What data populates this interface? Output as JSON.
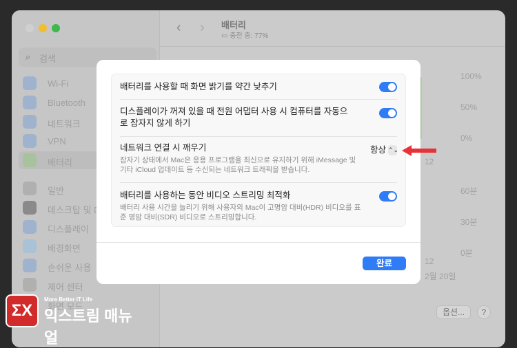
{
  "window": {
    "traffic_lights": [
      "#d0d0d0",
      "#f2be2c",
      "#3cb94a"
    ]
  },
  "sidebar": {
    "search_placeholder": "검색",
    "items": [
      {
        "label": "Wi-Fi",
        "icon": "wifi-icon"
      },
      {
        "label": "Bluetooth",
        "icon": "bluetooth-icon"
      },
      {
        "label": "네트워크",
        "icon": "globe-icon"
      },
      {
        "label": "VPN",
        "icon": "vpn-icon"
      },
      {
        "label": "배터리",
        "icon": "battery-icon",
        "selected": true
      },
      {
        "label": "일반",
        "icon": "gear-icon"
      },
      {
        "label": "데스크탑 및 Dock",
        "icon": "dock-icon"
      },
      {
        "label": "디스플레이",
        "icon": "sun-icon"
      },
      {
        "label": "배경화면",
        "icon": "wallpaper-icon"
      },
      {
        "label": "손쉬운 사용",
        "icon": "accessibility-icon"
      },
      {
        "label": "제어 센터",
        "icon": "control-center-icon"
      },
      {
        "label": "화면 모드",
        "icon": "screen-mode-icon"
      }
    ]
  },
  "header": {
    "title": "배터리",
    "status": "충전 중: 77%"
  },
  "chart": {
    "level_ticks": [
      "100%",
      "50%",
      "0%"
    ],
    "time_ticks": [
      "60분",
      "30분",
      "0분"
    ],
    "x_label_1": "12",
    "x_label_2": "12",
    "date": "2월 20일"
  },
  "footer": {
    "options": "옵션...",
    "help": "?"
  },
  "dialog": {
    "rows": [
      {
        "title": "배터리를 사용할 때 화면 밝기를 약간 낮추기",
        "toggle": true
      },
      {
        "title": "디스플레이가 꺼져 있을 때 전원 어댑터 사용 시 컴퓨터를 자동으로 잠자지 않게 하기",
        "toggle": true
      },
      {
        "title": "네트워크 연결 시 깨우기",
        "desc": "잠자기 상태에서 Mac은 응용 프로그램을 최신으로 유지하기 위해 iMessage 및 기타 iCloud 업데이트 등 수신되는 네트워크 트래픽을 받습니다.",
        "value": "항상"
      },
      {
        "title": "배터리를 사용하는 동안 비디오 스트리밍 최적화",
        "desc": "배터리 사용 시간을 늘리기 위해 사용자의 Mac이 고명암 대비(HDR) 비디오를 표준 명암 대비(SDR) 비디오로 스트리밍합니다.",
        "toggle": true
      }
    ],
    "done": "완료"
  },
  "watermark": {
    "tagline": "More Better IT Life",
    "name": "익스트림 매뉴얼"
  },
  "colors": {
    "accent": "#2f7cf6",
    "arrow": "#e8323a"
  }
}
